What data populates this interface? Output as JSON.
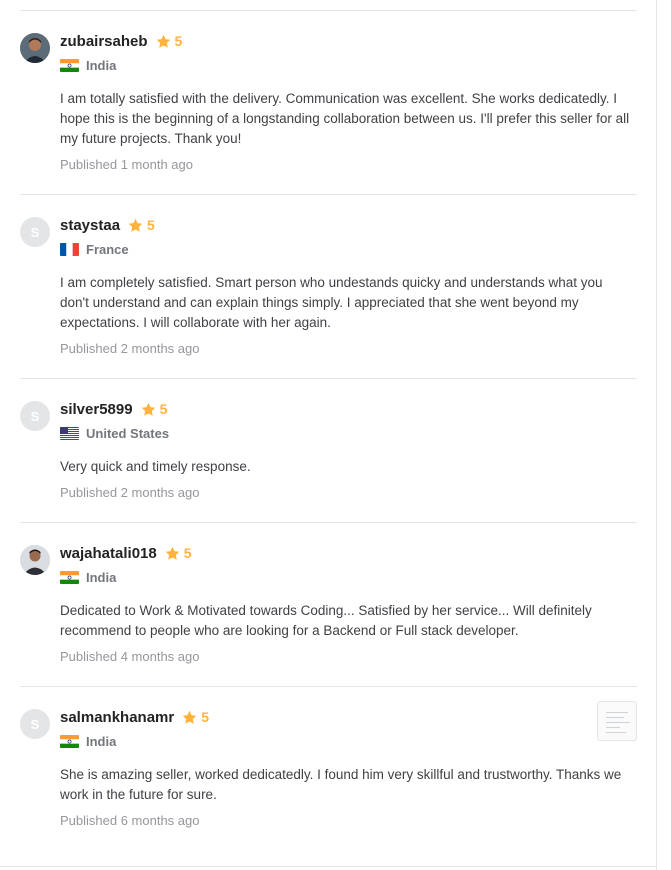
{
  "reviews": [
    {
      "username": "zubairsaheb",
      "rating": "5",
      "country": "India",
      "flag": "india",
      "avatar_type": "photo",
      "comment": "I am totally satisfied with the delivery. Communication was excellent. She works dedicatedly. I hope this is the beginning of a longstanding collaboration between us. I'll prefer this seller for all my future projects. Thank you!",
      "published": "Published 1 month ago"
    },
    {
      "username": "staystaa",
      "rating": "5",
      "country": "France",
      "flag": "france",
      "avatar_type": "initial",
      "avatar_initial": "S",
      "comment": "I am completely satisfied. Smart person who undestands quicky and understands what you don't understand and can explain things simply. I appreciated that she went beyond my expectations. I will collaborate with her again.",
      "published": "Published 2 months ago"
    },
    {
      "username": "silver5899",
      "rating": "5",
      "country": "United States",
      "flag": "usa",
      "avatar_type": "initial",
      "avatar_initial": "S",
      "comment": "Very quick and timely response.",
      "published": "Published 2 months ago"
    },
    {
      "username": "wajahatali018",
      "rating": "5",
      "country": "India",
      "flag": "india",
      "avatar_type": "photo",
      "comment": "Dedicated to Work & Motivated towards Coding... Satisfied by her service... Will definitely recommend to people who are looking for a Backend or Full stack developer.",
      "published": "Published 4 months ago"
    },
    {
      "username": "salmankhanamr",
      "rating": "5",
      "country": "India",
      "flag": "india",
      "avatar_type": "initial",
      "avatar_initial": "S",
      "comment": "She is amazing seller, worked dedicatedly. I found him very skillful and trustworthy. Thanks we work in the future for sure.",
      "published": "Published 6 months ago",
      "has_thumbnail": true
    }
  ],
  "colors": {
    "star": "#ffb33e",
    "divider": "#e4e5e7",
    "username": "#222325",
    "muted": "#95979d"
  }
}
